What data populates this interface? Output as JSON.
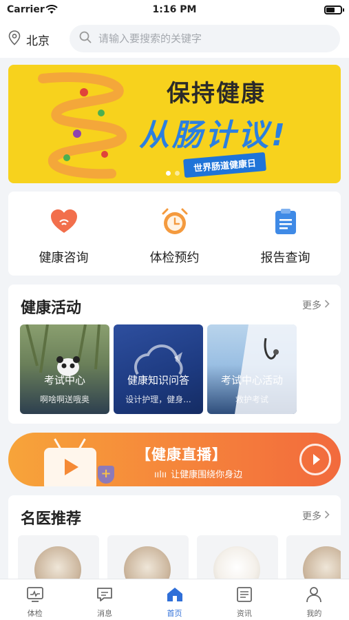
{
  "status_bar": {
    "carrier": "Carrier",
    "time": "1:16 PM"
  },
  "header": {
    "city": "北京",
    "search_placeholder": "请输入要搜索的关键字"
  },
  "banner": {
    "title_line1": "保持健康",
    "title_line2": "从肠计议!",
    "ribbon": "世界肠道健康日",
    "page_count": 2,
    "active_page": 1
  },
  "quick_menu": [
    {
      "label": "健康咨询",
      "icon": "heart-chat-icon",
      "color": "#f26f4c"
    },
    {
      "label": "体检预约",
      "icon": "alarm-clock-icon",
      "color": "#f49a3e"
    },
    {
      "label": "报告查询",
      "icon": "clipboard-icon",
      "color": "#3f8ae6"
    }
  ],
  "activities": {
    "title": "健康活动",
    "more": "更多",
    "cards": [
      {
        "title": "考试中心",
        "subtitle": "啊啥啊送哦奥"
      },
      {
        "title": "健康知识问答",
        "subtitle": "设计护理，健身..."
      },
      {
        "title": "考试中心活动",
        "subtitle": "救护考试"
      }
    ]
  },
  "live": {
    "title": "【健康直播】",
    "subtitle": "让健康围绕你身边"
  },
  "doctors": {
    "title": "名医推荐",
    "more": "更多"
  },
  "tabbar": [
    {
      "label": "体检",
      "icon": "monitor-icon",
      "active": false
    },
    {
      "label": "消息",
      "icon": "message-icon",
      "active": false
    },
    {
      "label": "首页",
      "icon": "home-icon",
      "active": true
    },
    {
      "label": "资讯",
      "icon": "news-icon",
      "active": false
    },
    {
      "label": "我的",
      "icon": "user-icon",
      "active": false
    }
  ],
  "colors": {
    "accent": "#2f6fd8",
    "banner_bg": "#f7d21d",
    "live_orange": "#f5833b"
  }
}
